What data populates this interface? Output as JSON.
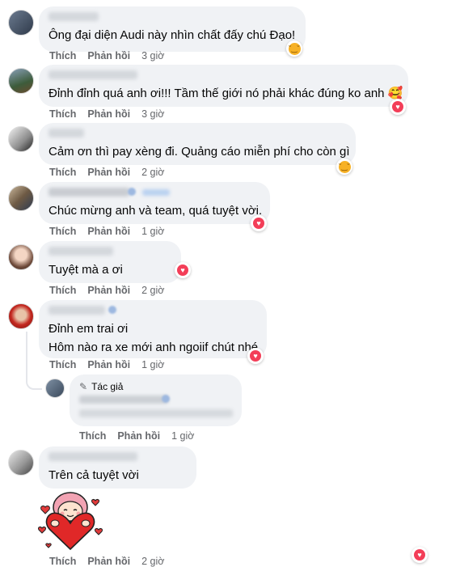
{
  "comments": [
    {
      "text": "Ông đại diện Audi này nhìn chất đấy chú Đạo!",
      "reaction": "haha",
      "like": "Thích",
      "reply": "Phản hồi",
      "time": "3 giờ"
    },
    {
      "text": "Đỉnh đỉnh quá anh ơi!!! Tầm thế giới nó phải khác đúng ko anh 🥰",
      "reaction": "love",
      "like": "Thích",
      "reply": "Phản hồi",
      "time": "3 giờ"
    },
    {
      "text": "Cảm ơn thì pay xèng đi. Quảng cáo miễn phí cho còn gì",
      "reaction": "haha",
      "like": "Thích",
      "reply": "Phản hồi",
      "time": "2 giờ"
    },
    {
      "text": "Chúc mừng anh và team, quá tuyệt vời.",
      "reaction": "love",
      "like": "Thích",
      "reply": "Phản hồi",
      "time": "1 giờ"
    },
    {
      "text": "Tuyệt mà a ơi",
      "reaction": "love",
      "like": "Thích",
      "reply": "Phản hồi",
      "time": "2 giờ"
    },
    {
      "text_lines": [
        "Đỉnh em trai ơi",
        "Hôm nào ra xe mới anh ngoiif chút nhé"
      ],
      "reaction": "love",
      "like": "Thích",
      "reply": "Phản hồi",
      "time": "1 giờ"
    },
    {
      "author_tag": "Tác giả",
      "like": "Thích",
      "reply": "Phản hồi",
      "time": "1 giờ"
    },
    {
      "text": "Trên cả tuyệt vời",
      "reaction": "love",
      "like": "Thích",
      "reply": "Phản hồi",
      "time": "2 giờ"
    }
  ],
  "colors": {
    "bubble": "#f0f2f5",
    "meta": "#65676b",
    "love": "#f33e58",
    "haha": "#f7b125"
  }
}
